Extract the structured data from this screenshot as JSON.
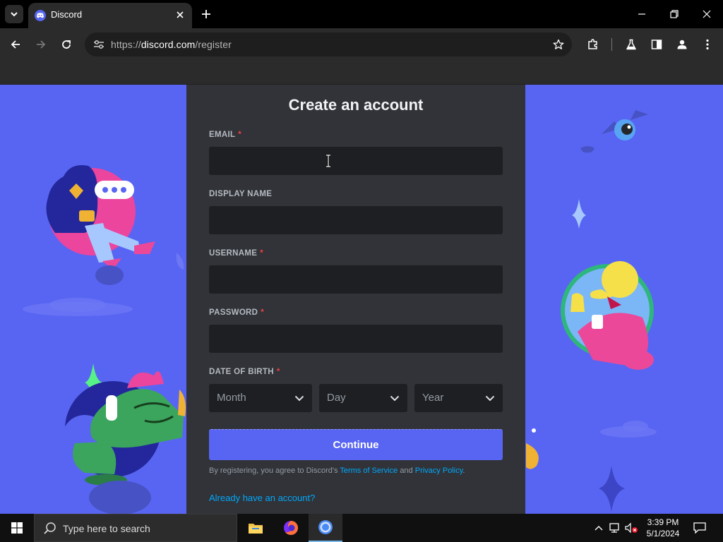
{
  "browser": {
    "tab_title": "Discord",
    "url_prefix": "https://",
    "url_domain": "discord.com",
    "url_path": "/register"
  },
  "form": {
    "title": "Create an account",
    "email_label": "EMAIL",
    "display_name_label": "DISPLAY NAME",
    "username_label": "USERNAME",
    "password_label": "PASSWORD",
    "dob_label": "DATE OF BIRTH",
    "required_mark": "*",
    "email_value": "",
    "display_name_value": "",
    "username_value": "",
    "password_value": "",
    "month_placeholder": "Month",
    "day_placeholder": "Day",
    "year_placeholder": "Year",
    "continue_label": "Continue",
    "terms_prefix": "By registering, you agree to Discord's",
    "terms_link": "Terms of Service",
    "terms_and": "and",
    "privacy_link": "Privacy Policy",
    "terms_suffix": ".",
    "login_link": "Already have an account?"
  },
  "taskbar": {
    "search_placeholder": "Type here to search",
    "time": "3:39 PM",
    "date": "5/1/2024"
  },
  "colors": {
    "brand": "#5865f2",
    "modal_bg": "#313338",
    "input_bg": "#1e1f22",
    "link": "#00a8fc",
    "required": "#f23f42"
  }
}
